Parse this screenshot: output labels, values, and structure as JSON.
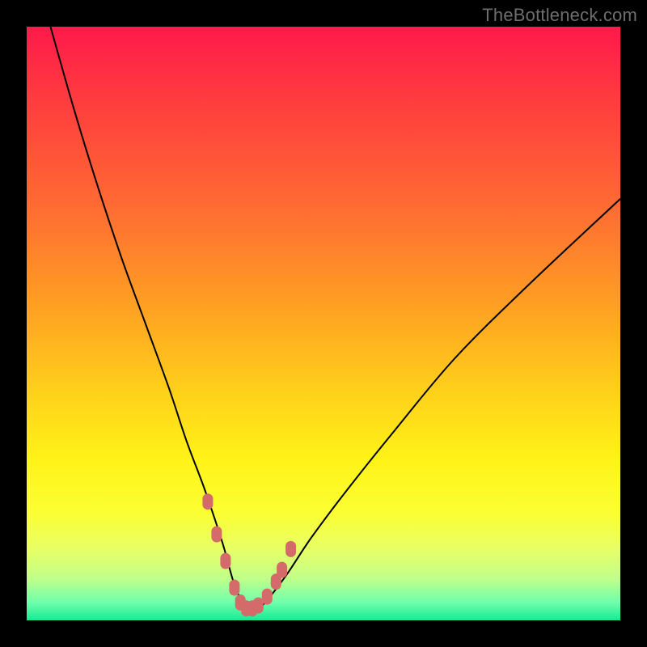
{
  "watermark": {
    "text": "TheBottleneck.com"
  },
  "colors": {
    "frame": "#000000",
    "curve_stroke": "#000000",
    "marker_fill": "#d46a6a",
    "gradient_stops": [
      {
        "offset": 0.0,
        "color": "#ff1a4b"
      },
      {
        "offset": 0.12,
        "color": "#ff3b3f"
      },
      {
        "offset": 0.3,
        "color": "#ff6a33"
      },
      {
        "offset": 0.48,
        "color": "#ffa322"
      },
      {
        "offset": 0.62,
        "color": "#ffd21a"
      },
      {
        "offset": 0.73,
        "color": "#fff318"
      },
      {
        "offset": 0.82,
        "color": "#fbff33"
      },
      {
        "offset": 0.88,
        "color": "#e8ff66"
      },
      {
        "offset": 0.93,
        "color": "#c0ff8a"
      },
      {
        "offset": 0.97,
        "color": "#6fffac"
      },
      {
        "offset": 1.0,
        "color": "#19e893"
      }
    ]
  },
  "chart_data": {
    "type": "line",
    "title": "",
    "xlabel": "",
    "ylabel": "",
    "xlim": [
      0,
      100
    ],
    "ylim": [
      0,
      100
    ],
    "axes_visible": false,
    "grid": false,
    "legend": false,
    "note": "y is bottleneck percentage (0 at bottom / green, 100 at top / red). Curve is a V-shaped bottleneck curve with minimum around x≈37.",
    "series": [
      {
        "name": "bottleneck-curve",
        "x": [
          4,
          8,
          12,
          16,
          20,
          24,
          27,
          30,
          33,
          35,
          37,
          39,
          41,
          44,
          48,
          54,
          62,
          72,
          84,
          100
        ],
        "y": [
          100,
          86,
          73,
          61,
          50,
          39,
          30,
          22,
          13,
          6,
          2,
          2,
          4,
          8,
          14,
          22,
          32,
          44,
          56,
          71
        ]
      }
    ],
    "markers": {
      "name": "near-optimum-dots",
      "x": [
        30.5,
        32.0,
        33.5,
        35.0,
        36.0,
        37.0,
        38.0,
        39.0,
        40.5,
        42.0,
        43.0,
        44.5
      ],
      "y": [
        20.0,
        14.5,
        10.0,
        5.5,
        3.0,
        2.0,
        2.0,
        2.5,
        4.0,
        6.5,
        8.5,
        12.0
      ]
    }
  }
}
